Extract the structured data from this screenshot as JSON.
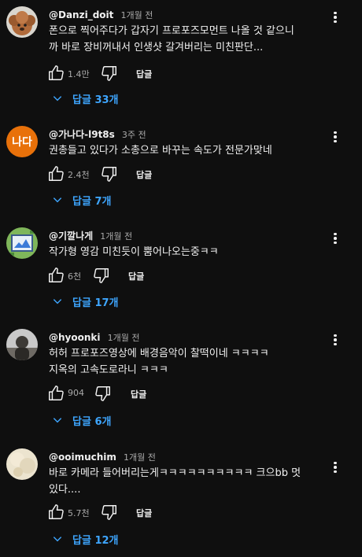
{
  "colors": {
    "background": "#0f0f0f",
    "text": "#f1f1f1",
    "muted": "#aaaaaa",
    "link": "#3ea6ff"
  },
  "comments": [
    {
      "handle": "@Danzi_doit",
      "time": "1개월 전",
      "text": "폰으로 찍어주다가 갑자기 프로포즈모먼트 나올 것 같으니\n까 바로 장비꺼내서 인생샷 갈겨버리는 미친판단...",
      "likes": "1.4만",
      "reply_label": "답글",
      "replies_label": "답글 33개",
      "avatar_icon": "toy-poodle-avatar"
    },
    {
      "handle": "@가나다-l9t8s",
      "time": "3주 전",
      "text": "권총들고 있다가 소총으로 바꾸는 속도가 전문가맞네",
      "likes": "2.4천",
      "reply_label": "답글",
      "replies_label": "답글 7개",
      "avatar_text": "나다",
      "avatar_color": "#e8710a"
    },
    {
      "handle": "@기깔나게",
      "time": "1개월 전",
      "text": "작가형 영감 미친듯이 뿜어나오는중ㅋㅋ",
      "likes": "6천",
      "reply_label": "답글",
      "replies_label": "답글 17개",
      "avatar_icon": "pixel-art-avatar"
    },
    {
      "handle": "@hyoonki",
      "time": "1개월 전",
      "text": "허허 프로포즈영상에 배경음악이 찰떡이네 ㅋㅋㅋㅋ\n지옥의 고속도로라니 ㅋㅋㅋ",
      "likes": "904",
      "reply_label": "답글",
      "replies_label": "답글 6개",
      "avatar_icon": "photo-avatar"
    },
    {
      "handle": "@ooimuchim",
      "time": "1개월 전",
      "text": "바로 카메라 들어버리는게ㅋㅋㅋㅋㅋㅋㅋㅋㅋㅋ 크으bb 멋\n있다....",
      "likes": "5.7천",
      "reply_label": "답글",
      "replies_label": "답글 12개",
      "avatar_icon": "blurred-photo-avatar"
    }
  ]
}
